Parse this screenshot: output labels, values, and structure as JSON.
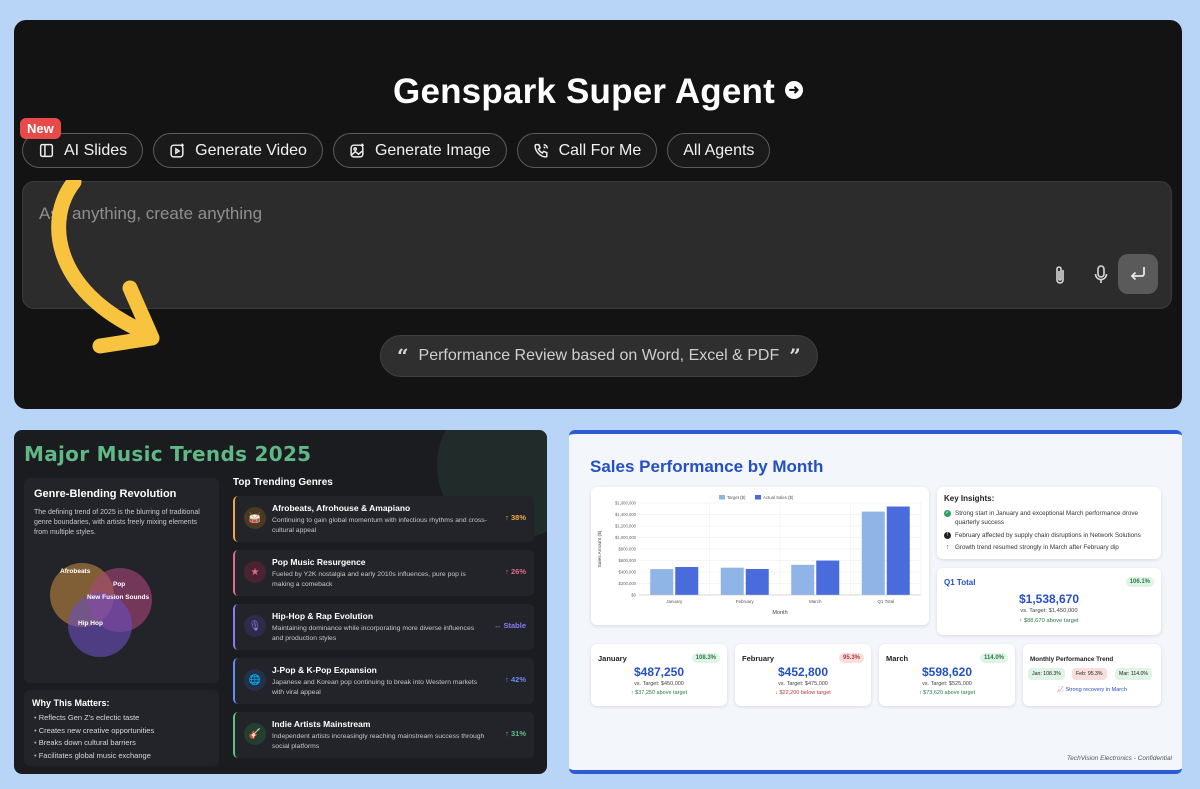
{
  "agent": {
    "title": "Genspark Super Agent",
    "new_badge": "New",
    "pills": [
      {
        "label": "AI Slides",
        "icon": "slides-icon"
      },
      {
        "label": "Generate Video",
        "icon": "video-icon"
      },
      {
        "label": "Generate Image",
        "icon": "image-icon"
      },
      {
        "label": "Call For Me",
        "icon": "phone-icon"
      },
      {
        "label": "All Agents",
        "icon": ""
      }
    ],
    "prompt_placeholder": "Ask anything, create anything",
    "suggestion": "Performance Review based on Word, Excel & PDF",
    "colors": {
      "background": "#131313",
      "badge": "#e84a4a",
      "arrow": "#f8c440"
    }
  },
  "music": {
    "title": "Major Music Trends 2025",
    "genre_card": {
      "heading": "Genre-Blending Revolution",
      "text": "The defining trend of 2025 is the blurring of traditional genre boundaries, with artists freely mixing elements from multiple styles.",
      "venn": [
        "Afrobeats",
        "Pop",
        "New Fusion Sounds",
        "Hip Hop"
      ]
    },
    "why": {
      "heading": "Why This Matters:",
      "items": [
        "Reflects Gen Z's eclectic taste",
        "Creates new creative opportunities",
        "Breaks down cultural barriers",
        "Facilitates global music exchange"
      ]
    },
    "top_heading": "Top Trending Genres",
    "trends": [
      {
        "title": "Afrobeats, Afrohouse & Amapiano",
        "desc": "Continuing to gain global momentum with infectious rhythms and cross-cultural appeal",
        "value": "↑ 38%",
        "color": "#f0a847"
      },
      {
        "title": "Pop Music Resurgence",
        "desc": "Fueled by Y2K nostalgia and early 2010s influences, pure pop is making a comeback",
        "value": "↑ 26%",
        "color": "#e46a8c"
      },
      {
        "title": "Hip-Hop & Rap Evolution",
        "desc": "Maintaining dominance while incorporating more diverse influences and production styles",
        "value": "↔ Stable",
        "color": "#8a7cf0"
      },
      {
        "title": "J-Pop & K-Pop Expansion",
        "desc": "Japanese and Korean pop continuing to break into Western markets with viral appeal",
        "value": "↑ 42%",
        "color": "#6a8cf0"
      },
      {
        "title": "Indie Artists Mainstream",
        "desc": "Independent artists increasingly reaching mainstream success through social platforms",
        "value": "↑ 31%",
        "color": "#5fc08a"
      }
    ]
  },
  "sales": {
    "title": "Sales Performance by Month",
    "insights": {
      "heading": "Key Insights:",
      "items": [
        "Strong start in January and exceptional March performance drove quarterly success",
        "February affected by supply chain disruptions in Network Solutions",
        "Growth trend resumed strongly in March after February dip"
      ]
    },
    "q1": {
      "label": "Q1 Total",
      "pct": "106.1%",
      "amount": "$1,538,670",
      "target": "vs. Target: $1,450,000",
      "diff": "$88,670 above target"
    },
    "months": [
      {
        "label": "January",
        "pct": "108.3%",
        "amount": "$487,250",
        "target": "vs. Target: $450,000",
        "diff": "$37,250 above target",
        "up": true
      },
      {
        "label": "February",
        "pct": "95.3%",
        "amount": "$452,800",
        "target": "vs. Target: $475,000",
        "diff": "$22,200 below target",
        "up": false
      },
      {
        "label": "March",
        "pct": "114.0%",
        "amount": "$598,620",
        "target": "vs. Target: $525,000",
        "diff": "$73,620 above target",
        "up": true
      }
    ],
    "trend_card": {
      "label": "Monthly Performance Trend",
      "chips": [
        "Jan: 108.3%",
        "Feb: 95.3%",
        "Mar: 114.0%"
      ],
      "note": "Strong recovery in March"
    },
    "footer": "TechVision Electronics - Confidential"
  },
  "chart_data": {
    "type": "bar",
    "categories": [
      "January",
      "February",
      "March",
      "Q1 Total"
    ],
    "series": [
      {
        "name": "Target ($)",
        "values": [
          450000,
          475000,
          525000,
          1450000
        ],
        "color": "#8fb4e6"
      },
      {
        "name": "Actual Sales ($)",
        "values": [
          487250,
          452800,
          598620,
          1538670
        ],
        "color": "#4a6bdc"
      }
    ],
    "xlabel": "Month",
    "ylabel": "Sales Amount ($)",
    "ylim": [
      0,
      1600000
    ],
    "yticks": [
      "$0",
      "$200,000",
      "$400,000",
      "$600,000",
      "$800,000",
      "$1,000,000",
      "$1,200,000",
      "$1,400,000",
      "$1,600,000"
    ],
    "legend": "top-center",
    "grid": true
  }
}
